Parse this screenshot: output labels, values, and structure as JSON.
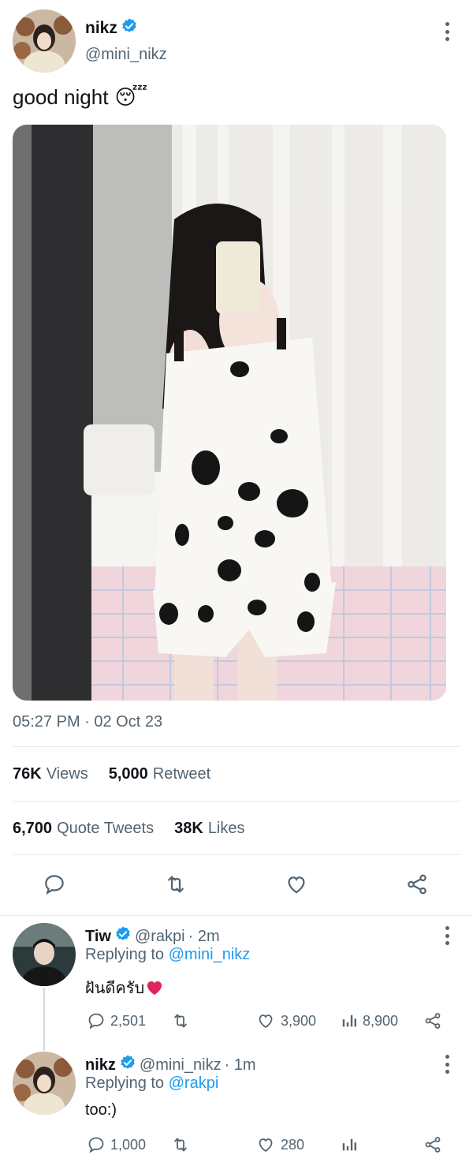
{
  "tweet": {
    "author_name": "nikz",
    "author_handle": "@mini_nikz",
    "text": "good night",
    "emoji": "😴",
    "timestamp": "05:27 PM · 02 Oct 23",
    "stats": {
      "views_num": "76K",
      "views_label": "Views",
      "retweets_num": "5,000",
      "retweets_label": "Retweet",
      "quotes_num": "6,700",
      "quotes_label": "Quote Tweets",
      "likes_num": "38K",
      "likes_label": "Likes"
    },
    "actions": [
      "reply-icon",
      "retweet-icon",
      "like-icon",
      "share-icon"
    ]
  },
  "replies": [
    {
      "name": "Tiw",
      "handle": "@rakpi",
      "time": "· 2m",
      "replying_prefix": "Replying to",
      "replying_to": "@mini_nikz",
      "text": "ฝันดีครับ",
      "emoji": "❤️",
      "replies_count": "2,501",
      "retweets_count": "",
      "likes_count": "3,900",
      "views_count": "8,900"
    },
    {
      "name": "nikz",
      "handle": "@mini_nikz",
      "time": "· 1m",
      "replying_prefix": "Replying to",
      "replying_to": "@rakpi",
      "text": "too:)",
      "replies_count": "1,000",
      "retweets_count": "",
      "likes_count": "280",
      "views_count": ""
    }
  ],
  "colors": {
    "accent": "#1d9bf0",
    "muted": "#536471",
    "text": "#0f1419",
    "heart": "#e0245e"
  }
}
